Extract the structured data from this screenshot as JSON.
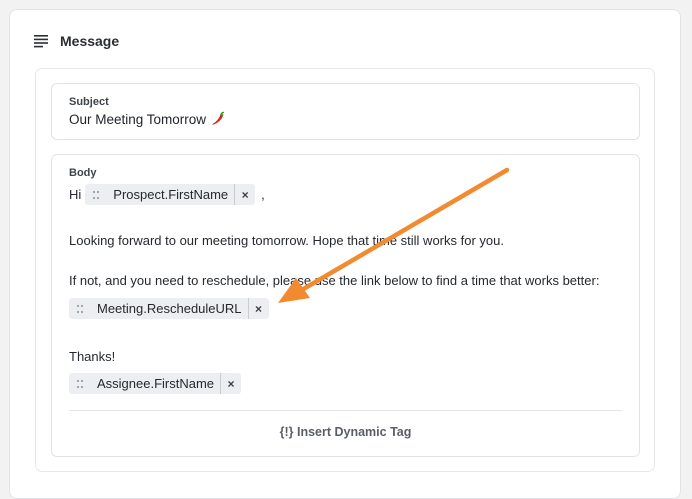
{
  "card": {
    "title": "Message",
    "icon": "menu-lines-icon"
  },
  "subject": {
    "label": "Subject",
    "value": "Our Meeting Tomorrow",
    "emoji_icon": "chili-pepper-icon"
  },
  "body": {
    "label": "Body",
    "greeting": "Hi",
    "greeting_suffix": ",",
    "tags": {
      "prospect": "Prospect.FirstName",
      "reschedule": "Meeting.RescheduleURL",
      "assignee": "Assignee.FirstName"
    },
    "line1": "Looking forward to our meeting tomorrow. Hope that time still works for you.",
    "line2": "If not, and you need to reschedule, please use the link below to find a time that works better:",
    "thanks": "Thanks!",
    "tag_remove_glyph": "×",
    "insert_button": "{!} Insert Dynamic Tag"
  },
  "annotation": {
    "arrow_color": "#f28a30"
  }
}
